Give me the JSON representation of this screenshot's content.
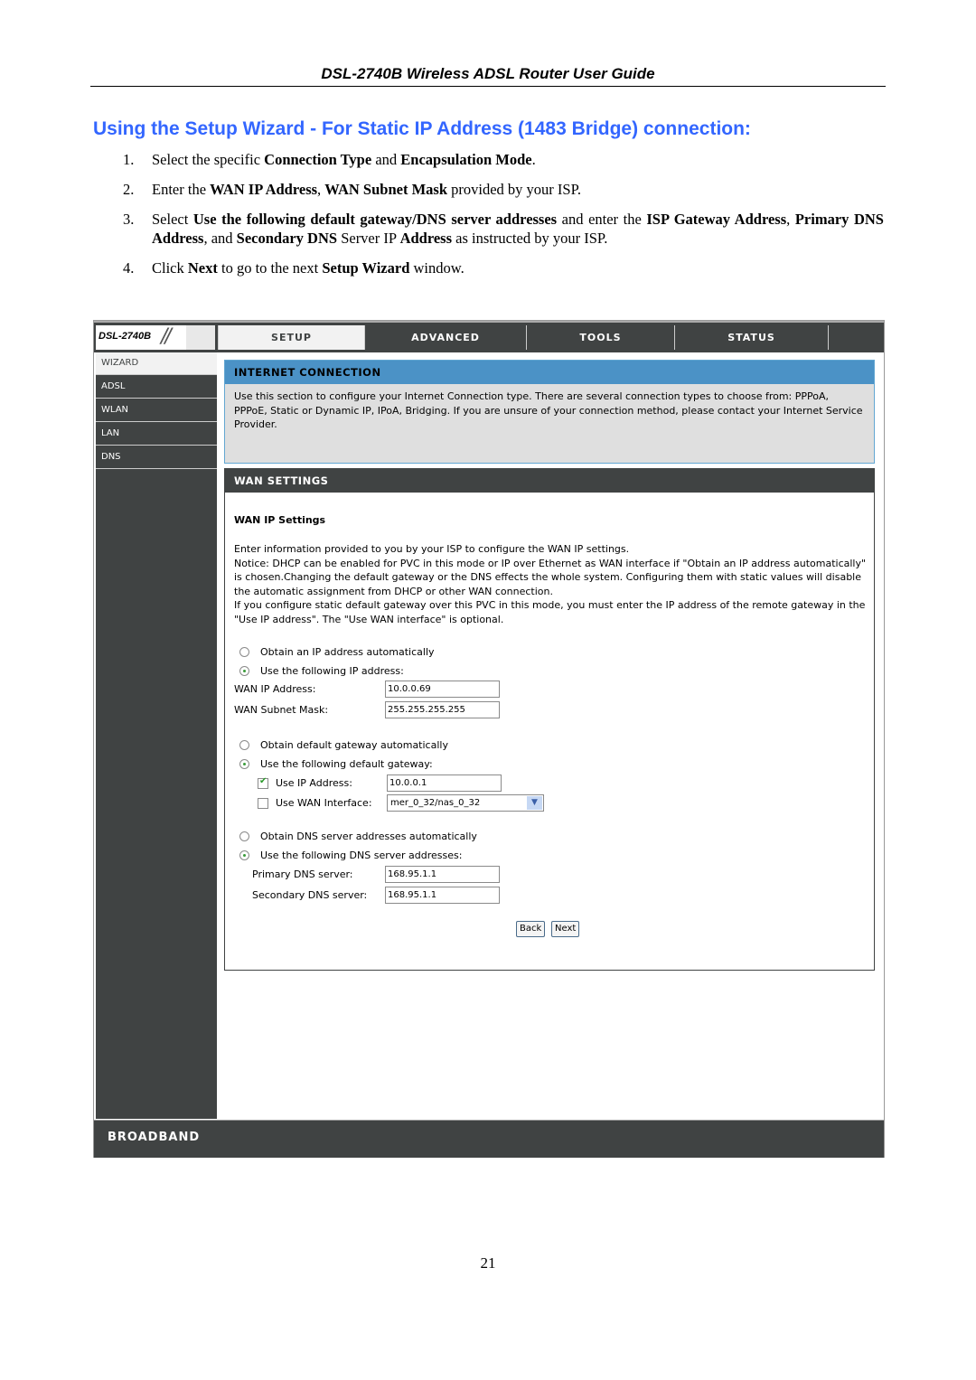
{
  "document": {
    "header": "DSL-2740B Wireless ADSL Router User Guide",
    "section_title": "Using the Setup Wizard - For Static IP Address (1483 Bridge) connection:",
    "page_number": "21",
    "steps": [
      {
        "num": "1.",
        "parts": [
          [
            "t",
            "Select the specific "
          ],
          [
            "b",
            "Connection Type"
          ],
          [
            "t",
            " and "
          ],
          [
            "b",
            "Encapsulation Mode"
          ],
          [
            "t",
            "."
          ]
        ]
      },
      {
        "num": "2.",
        "parts": [
          [
            "t",
            "Enter the "
          ],
          [
            "b",
            "WAN IP Address"
          ],
          [
            "t",
            ", "
          ],
          [
            "b",
            "WAN Subnet Mask"
          ],
          [
            "t",
            " provided by your ISP."
          ]
        ]
      },
      {
        "num": "3.",
        "parts": [
          [
            "t",
            "Select "
          ],
          [
            "b",
            "Use the following default gateway/DNS server addresses"
          ],
          [
            "t",
            " and enter the "
          ],
          [
            "b",
            "ISP Gateway Address"
          ],
          [
            "t",
            ", "
          ],
          [
            "b",
            "Primary DNS Address"
          ],
          [
            "t",
            ", and "
          ],
          [
            "b",
            "Secondary DNS"
          ],
          [
            "t",
            " Server IP "
          ],
          [
            "b",
            "Address"
          ],
          [
            "t",
            " as instructed by your ISP."
          ]
        ]
      },
      {
        "num": "4.",
        "parts": [
          [
            "t",
            "Click "
          ],
          [
            "b",
            "Next"
          ],
          [
            "t",
            " to go to the next "
          ],
          [
            "b",
            "Setup Wizard"
          ],
          [
            "t",
            " window."
          ]
        ]
      }
    ]
  },
  "router": {
    "logo": "DSL-2740B",
    "tabs": [
      {
        "label": "SETUP",
        "active": true
      },
      {
        "label": "ADVANCED",
        "active": false
      },
      {
        "label": "TOOLS",
        "active": false
      },
      {
        "label": "STATUS",
        "active": false
      }
    ],
    "sidebar": [
      {
        "label": "WIZARD",
        "active": true
      },
      {
        "label": "ADSL",
        "active": false
      },
      {
        "label": "WLAN",
        "active": false
      },
      {
        "label": "LAN",
        "active": false
      },
      {
        "label": "DNS",
        "active": false
      }
    ],
    "internet_connection": {
      "title": "INTERNET CONNECTION",
      "body": "Use this section to configure your Internet Connection type. There are several connection types to choose from: PPPoA, PPPoE, Static or Dynamic IP, IPoA, Bridging. If you are unsure of your connection method, please contact your Internet Service Provider."
    },
    "wan_settings": {
      "title": "WAN SETTINGS",
      "subtitle": "WAN IP Settings",
      "description": [
        "Enter information provided to you by your ISP to configure the WAN IP settings.",
        "Notice: DHCP can be enabled for PVC in this mode or IP over Ethernet as WAN interface if \"Obtain an IP address automatically\" is chosen.Changing the default gateway or the DNS effects the whole system. Configuring them with static values will disable the automatic assignment from DHCP or other WAN connection.",
        "If you configure static default gateway over this PVC in this mode, you must enter the IP address of the remote gateway in the \"Use IP address\". The \"Use WAN interface\" is optional."
      ],
      "ip_obtain_auto": {
        "label": "Obtain an IP address automatically",
        "selected": false
      },
      "ip_use_following": {
        "label": "Use the following IP address:",
        "selected": true
      },
      "wan_ip_label": "WAN IP Address:",
      "wan_ip_value": "10.0.0.69",
      "wan_mask_label": "WAN Subnet Mask:",
      "wan_mask_value": "255.255.255.255",
      "gw_obtain_auto": {
        "label": "Obtain default gateway automatically",
        "selected": false
      },
      "gw_use_following": {
        "label": "Use the following default gateway:",
        "selected": true
      },
      "use_ip_address": {
        "label": "Use IP Address:",
        "checked": true,
        "value": "10.0.0.1"
      },
      "use_wan_interface": {
        "label": "Use WAN Interface:",
        "checked": false,
        "value": "mer_0_32/nas_0_32"
      },
      "dns_obtain_auto": {
        "label": "Obtain DNS server addresses automatically",
        "selected": false
      },
      "dns_use_following": {
        "label": "Use the following DNS server addresses:",
        "selected": true
      },
      "primary_dns_label": "Primary DNS server:",
      "primary_dns_value": "168.95.1.1",
      "secondary_dns_label": "Secondary DNS server:",
      "secondary_dns_value": "168.95.1.1",
      "back_label": "Back",
      "next_label": "Next"
    },
    "footer": "BROADBAND"
  }
}
